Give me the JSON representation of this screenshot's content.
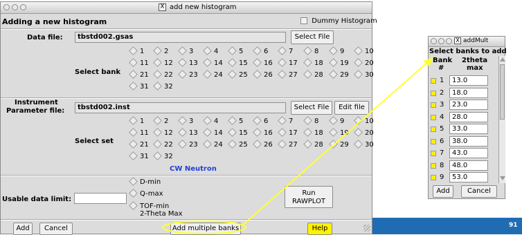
{
  "main_window": {
    "title": "add new histogram",
    "header_label": "Adding a new histogram",
    "dummy_label": "Dummy Histogram",
    "data_file": {
      "label": "Data file:",
      "value": "tbstd002.gsas",
      "select_button": "Select File",
      "select_bank_label": "Select bank",
      "banks": [
        "1",
        "2",
        "3",
        "4",
        "5",
        "6",
        "7",
        "8",
        "9",
        "10",
        "11",
        "12",
        "13",
        "14",
        "15",
        "16",
        "17",
        "18",
        "19",
        "20",
        "21",
        "22",
        "23",
        "24",
        "25",
        "26",
        "27",
        "28",
        "29",
        "30",
        "31",
        "32"
      ]
    },
    "instrument_file": {
      "label_line1": "Instrument",
      "label_line2": "Parameter file:",
      "value": "tbstd002.inst",
      "select_button": "Select File",
      "edit_button": "Edit file",
      "select_set_label": "Select set",
      "sets": [
        "1",
        "2",
        "3",
        "4",
        "5",
        "6",
        "7",
        "8",
        "9",
        "10",
        "11",
        "12",
        "13",
        "14",
        "15",
        "16",
        "17",
        "18",
        "19",
        "20",
        "21",
        "22",
        "23",
        "24",
        "25",
        "26",
        "27",
        "28",
        "29",
        "30",
        "31",
        "32"
      ],
      "type_label": "CW Neutron"
    },
    "limit": {
      "label": "Usable data limit:",
      "value": "",
      "options": [
        "D-min",
        "Q-max",
        "TOF-min",
        "2-Theta Max"
      ],
      "run_line1": "Run",
      "run_line2": "RAWPLOT"
    },
    "footer": {
      "add": "Add",
      "cancel": "Cancel",
      "add_multiple": "Add multiple banks",
      "help": "Help"
    }
  },
  "popup_window": {
    "title": "addMult",
    "heading": "Select banks to add",
    "col_bank": "Bank",
    "col_bank_sub": "#",
    "col_theta": "2theta",
    "col_theta_sub": "max",
    "rows": [
      {
        "bank": "1",
        "theta": "13.0"
      },
      {
        "bank": "2",
        "theta": "18.0"
      },
      {
        "bank": "3",
        "theta": "23.0"
      },
      {
        "bank": "4",
        "theta": "28.0"
      },
      {
        "bank": "5",
        "theta": "33.0"
      },
      {
        "bank": "6",
        "theta": "38.0"
      },
      {
        "bank": "7",
        "theta": "43.0"
      },
      {
        "bank": "8",
        "theta": "48.0"
      },
      {
        "bank": "9",
        "theta": "53.0"
      }
    ],
    "add": "Add",
    "cancel": "Cancel"
  },
  "slide": {
    "page_number": "91"
  },
  "colors": {
    "highlight": "#fff200",
    "annotation_line": "#ffff33",
    "footer_bar": "#1f6cb3",
    "accent_text": "#1f3fd6"
  }
}
